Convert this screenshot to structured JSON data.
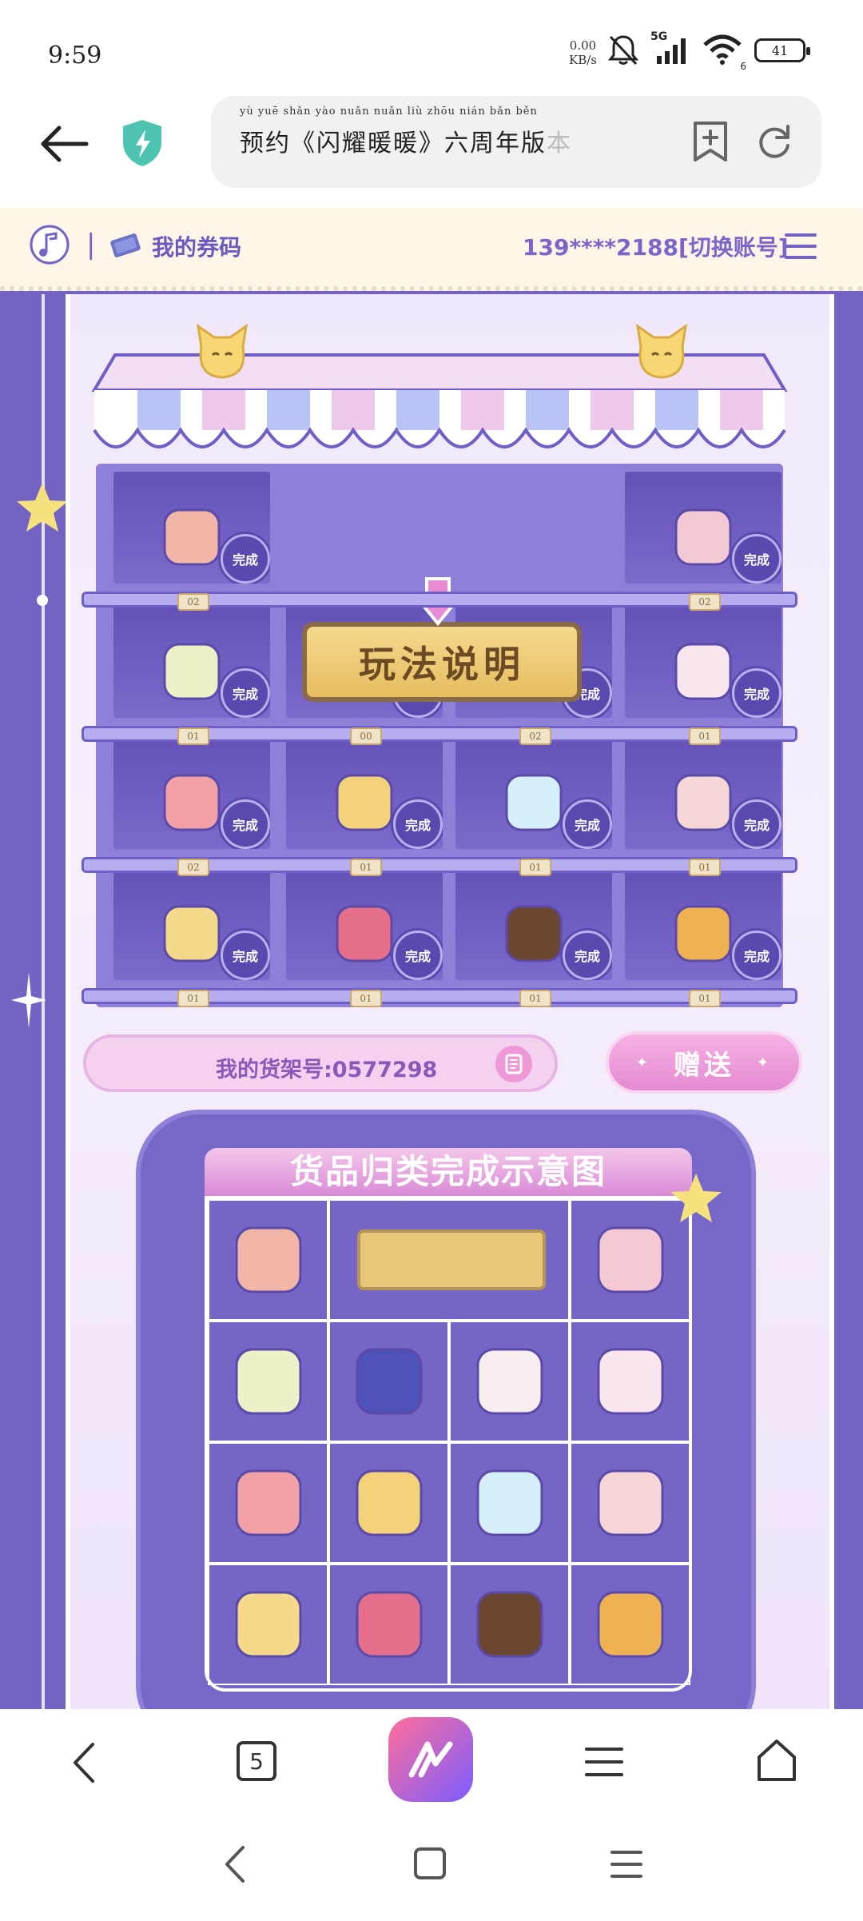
{
  "status_bar": {
    "time": "9:59",
    "net_speed_value": "0.00",
    "net_speed_unit": "KB/s",
    "network_type": "5G",
    "wifi_label": "6",
    "battery_level": "41"
  },
  "browser": {
    "url_text": "预约《闪耀暖暖》六周年版",
    "url_text_fade": "本",
    "url_pinyin": "yù yuē     shǎn yào nuǎn nuǎn     liù zhōu nián bǎn běn"
  },
  "header": {
    "coupon_label": "我的券码",
    "account_text": "139****2188[切换账号]"
  },
  "shelf": {
    "rules_label": "玩法说明",
    "done_label": "完成",
    "tags": [
      "02",
      "02",
      "01",
      "00",
      "02",
      "01",
      "02",
      "01",
      "01",
      "01",
      "01",
      "01",
      "01",
      "01"
    ],
    "shelf_number": "我的货架号:0577298",
    "gift_label": "赠送"
  },
  "example": {
    "title": "货品归类完成示意图"
  },
  "bottom_nav": {
    "tab_count": "5"
  },
  "colors": {
    "accent_purple": "#7563c3",
    "pink": "#e58ad3",
    "gold": "#e6bd60"
  }
}
